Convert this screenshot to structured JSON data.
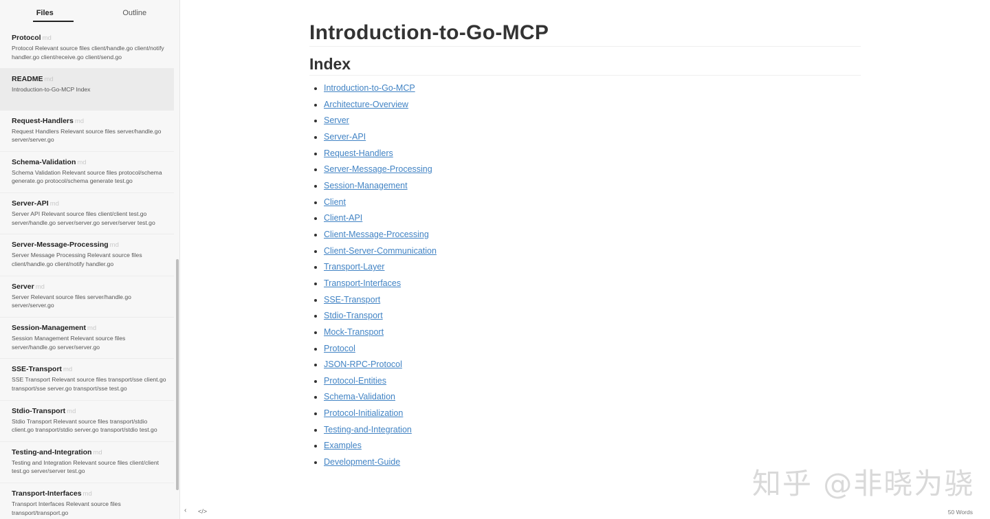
{
  "sidebar": {
    "tabs": [
      {
        "label": "Files",
        "active": true
      },
      {
        "label": "Outline",
        "active": false
      }
    ],
    "files": [
      {
        "name": "Protocol",
        "ext": "md",
        "desc": "Protocol Relevant source files client/handle.go client/notify handler.go client/receive.go client/send.go"
      },
      {
        "name": "README",
        "ext": "md",
        "desc": "Introduction-to-Go-MCP Index",
        "selected": true
      },
      {
        "name": "Request-Handlers",
        "ext": "md",
        "desc": "Request Handlers Relevant source files server/handle.go server/server.go"
      },
      {
        "name": "Schema-Validation",
        "ext": "md",
        "desc": "Schema Validation Relevant source files protocol/schema generate.go protocol/schema generate test.go"
      },
      {
        "name": "Server-API",
        "ext": "md",
        "desc": "Server API Relevant source files client/client test.go server/handle.go server/server.go server/server test.go"
      },
      {
        "name": "Server-Message-Processing",
        "ext": "md",
        "desc": "Server Message Processing Relevant source files client/handle.go client/notify handler.go"
      },
      {
        "name": "Server",
        "ext": "md",
        "desc": "Server Relevant source files server/handle.go server/server.go"
      },
      {
        "name": "Session-Management",
        "ext": "md",
        "desc": "Session Management Relevant source files server/handle.go server/server.go"
      },
      {
        "name": "SSE-Transport",
        "ext": "md",
        "desc": "SSE Transport Relevant source files transport/sse client.go transport/sse server.go transport/sse test.go"
      },
      {
        "name": "Stdio-Transport",
        "ext": "md",
        "desc": "Stdio Transport Relevant source files transport/stdio client.go transport/stdio server.go transport/stdio test.go"
      },
      {
        "name": "Testing-and-Integration",
        "ext": "md",
        "desc": "Testing and Integration Relevant source files client/client test.go server/server test.go"
      },
      {
        "name": "Transport-Interfaces",
        "ext": "md",
        "desc": "Transport Interfaces Relevant source files transport/transport.go"
      }
    ]
  },
  "document": {
    "title": "Introduction-to-Go-MCP",
    "section": "Index",
    "links": [
      "Introduction-to-Go-MCP",
      "Architecture-Overview",
      "Server",
      "Server-API",
      "Request-Handlers",
      "Server-Message-Processing",
      "Session-Management",
      "Client",
      "Client-API",
      "Client-Message-Processing",
      "Client-Server-Communication",
      "Transport-Layer",
      "Transport-Interfaces",
      "SSE-Transport",
      "Stdio-Transport",
      "Mock-Transport",
      "Protocol",
      "JSON-RPC-Protocol",
      "Protocol-Entities",
      "Schema-Validation",
      "Protocol-Initialization",
      "Testing-and-Integration",
      "Examples",
      "Development-Guide"
    ]
  },
  "footer": {
    "back_icon": "‹",
    "source_icon": "</>",
    "word_count": "50 Words"
  },
  "watermark": "知乎 @非晓为骁",
  "colors": {
    "link": "#4183c4",
    "sidebar_bg": "#f7f7f7",
    "selected_bg": "#ebebeb"
  }
}
